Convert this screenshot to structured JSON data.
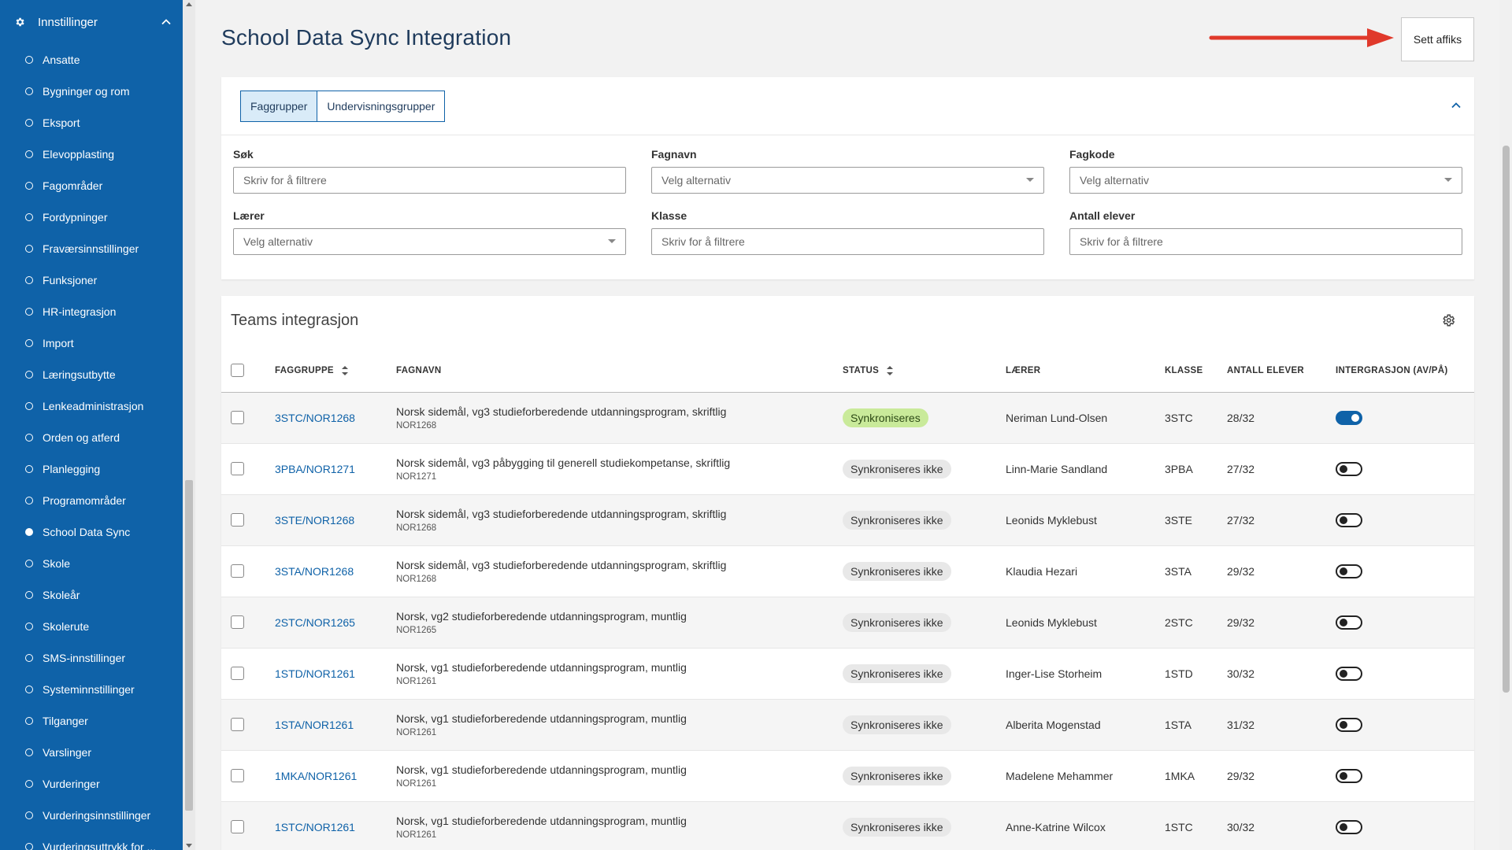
{
  "sidebar": {
    "header_label": "Innstillinger",
    "items": [
      {
        "label": "Ansatte",
        "active": false
      },
      {
        "label": "Bygninger og rom",
        "active": false
      },
      {
        "label": "Eksport",
        "active": false
      },
      {
        "label": "Elevopplasting",
        "active": false
      },
      {
        "label": "Fagområder",
        "active": false
      },
      {
        "label": "Fordypninger",
        "active": false
      },
      {
        "label": "Fraværsinnstillinger",
        "active": false
      },
      {
        "label": "Funksjoner",
        "active": false
      },
      {
        "label": "HR-integrasjon",
        "active": false
      },
      {
        "label": "Import",
        "active": false
      },
      {
        "label": "Læringsutbytte",
        "active": false
      },
      {
        "label": "Lenkeadministrasjon",
        "active": false
      },
      {
        "label": "Orden og atferd",
        "active": false
      },
      {
        "label": "Planlegging",
        "active": false
      },
      {
        "label": "Programområder",
        "active": false
      },
      {
        "label": "School Data Sync",
        "active": true
      },
      {
        "label": "Skole",
        "active": false
      },
      {
        "label": "Skoleår",
        "active": false
      },
      {
        "label": "Skolerute",
        "active": false
      },
      {
        "label": "SMS-innstillinger",
        "active": false
      },
      {
        "label": "Systeminnstillinger",
        "active": false
      },
      {
        "label": "Tilganger",
        "active": false
      },
      {
        "label": "Varslinger",
        "active": false
      },
      {
        "label": "Vurderinger",
        "active": false
      },
      {
        "label": "Vurderingsinnstillinger",
        "active": false
      },
      {
        "label": "Vurderingsuttrykk for ...",
        "active": false
      }
    ]
  },
  "header": {
    "title": "School Data Sync Integration",
    "affix_button": "Sett affiks"
  },
  "filters": {
    "tabs": [
      {
        "label": "Faggrupper",
        "active": true
      },
      {
        "label": "Undervisningsgrupper",
        "active": false
      }
    ],
    "fields": [
      {
        "label": "Søk",
        "placeholder": "Skriv for å filtrere",
        "type": "text"
      },
      {
        "label": "Fagnavn",
        "placeholder": "Velg alternativ",
        "type": "select"
      },
      {
        "label": "Fagkode",
        "placeholder": "Velg alternativ",
        "type": "select"
      },
      {
        "label": "Lærer",
        "placeholder": "Velg alternativ",
        "type": "select"
      },
      {
        "label": "Klasse",
        "placeholder": "Skriv for å filtrere",
        "type": "text"
      },
      {
        "label": "Antall elever",
        "placeholder": "Skriv for å filtrere",
        "type": "text"
      }
    ]
  },
  "teams": {
    "title": "Teams integrasjon",
    "columns": {
      "faggruppe": "FAGGRUPPE",
      "fagnavn": "FAGNAVN",
      "status": "STATUS",
      "laerer": "LÆRER",
      "klasse": "KLASSE",
      "antall": "ANTALL ELEVER",
      "integrasjon": "INTERGRASJON (AV/PÅ)"
    },
    "rows": [
      {
        "faggruppe": "3STC/NOR1268",
        "fagnavn": "Norsk sidemål, vg3 studieforberedende utdanningsprogram, skriftlig",
        "fagkode": "NOR1268",
        "status": "Synkroniseres",
        "synced": true,
        "laerer": "Neriman Lund-Olsen",
        "klasse": "3STC",
        "antall": "28/32"
      },
      {
        "faggruppe": "3PBA/NOR1271",
        "fagnavn": "Norsk sidemål, vg3 påbygging til generell studiekompetanse, skriftlig",
        "fagkode": "NOR1271",
        "status": "Synkroniseres ikke",
        "synced": false,
        "laerer": "Linn-Marie Sandland",
        "klasse": "3PBA",
        "antall": "27/32"
      },
      {
        "faggruppe": "3STE/NOR1268",
        "fagnavn": "Norsk sidemål, vg3 studieforberedende utdanningsprogram, skriftlig",
        "fagkode": "NOR1268",
        "status": "Synkroniseres ikke",
        "synced": false,
        "laerer": "Leonids Myklebust",
        "klasse": "3STE",
        "antall": "27/32"
      },
      {
        "faggruppe": "3STA/NOR1268",
        "fagnavn": "Norsk sidemål, vg3 studieforberedende utdanningsprogram, skriftlig",
        "fagkode": "NOR1268",
        "status": "Synkroniseres ikke",
        "synced": false,
        "laerer": "Klaudia Hezari",
        "klasse": "3STA",
        "antall": "29/32"
      },
      {
        "faggruppe": "2STC/NOR1265",
        "fagnavn": "Norsk, vg2 studieforberedende utdanningsprogram, muntlig",
        "fagkode": "NOR1265",
        "status": "Synkroniseres ikke",
        "synced": false,
        "laerer": "Leonids Myklebust",
        "klasse": "2STC",
        "antall": "29/32"
      },
      {
        "faggruppe": "1STD/NOR1261",
        "fagnavn": "Norsk, vg1 studieforberedende utdanningsprogram, muntlig",
        "fagkode": "NOR1261",
        "status": "Synkroniseres ikke",
        "synced": false,
        "laerer": "Inger-Lise Storheim",
        "klasse": "1STD",
        "antall": "30/32"
      },
      {
        "faggruppe": "1STA/NOR1261",
        "fagnavn": "Norsk, vg1 studieforberedende utdanningsprogram, muntlig",
        "fagkode": "NOR1261",
        "status": "Synkroniseres ikke",
        "synced": false,
        "laerer": "Alberita Mogenstad",
        "klasse": "1STA",
        "antall": "31/32"
      },
      {
        "faggruppe": "1MKA/NOR1261",
        "fagnavn": "Norsk, vg1 studieforberedende utdanningsprogram, muntlig",
        "fagkode": "NOR1261",
        "status": "Synkroniseres ikke",
        "synced": false,
        "laerer": "Madelene Mehammer",
        "klasse": "1MKA",
        "antall": "29/32"
      },
      {
        "faggruppe": "1STC/NOR1261",
        "fagnavn": "Norsk, vg1 studieforberedende utdanningsprogram, muntlig",
        "fagkode": "NOR1261",
        "status": "Synkroniseres ikke",
        "synced": false,
        "laerer": "Anne-Katrine Wilcox",
        "klasse": "1STC",
        "antall": "30/32"
      }
    ]
  },
  "colors": {
    "sidebar_bg": "#0f62a8",
    "accent": "#0f62a8",
    "synced_badge": "#c9ea9a",
    "arrow": "#e0392b"
  }
}
